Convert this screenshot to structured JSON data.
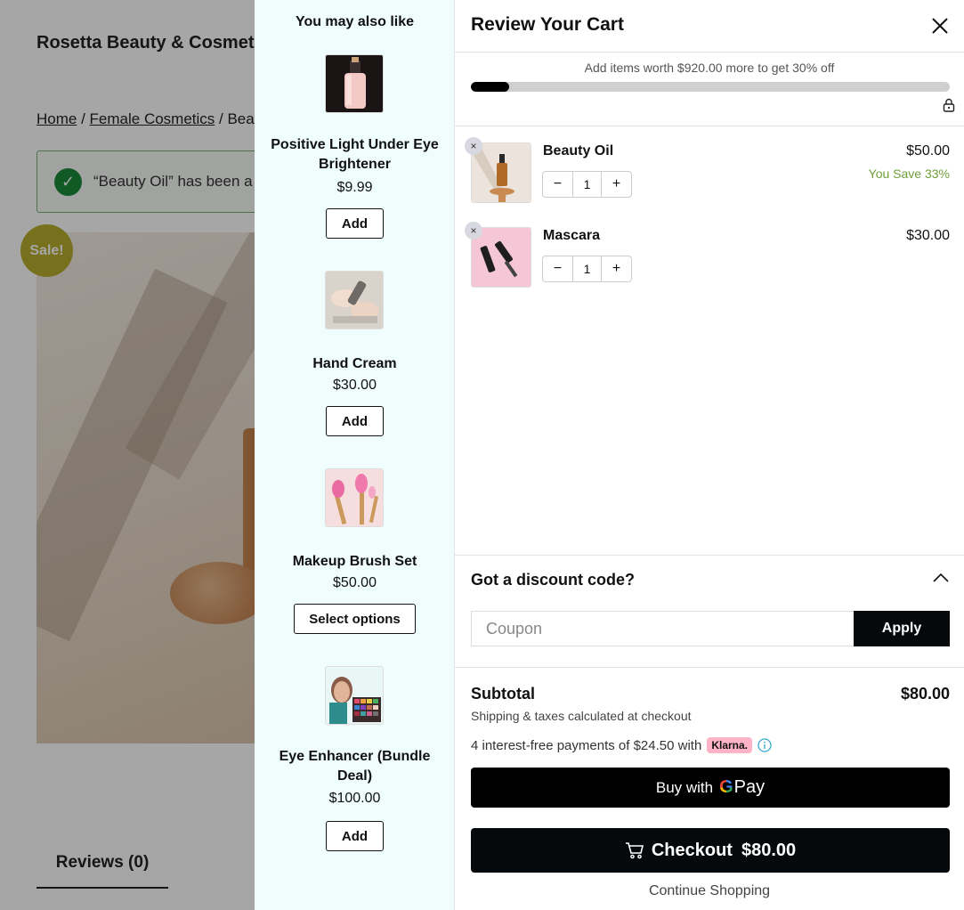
{
  "background_page": {
    "site_title": "Rosetta Beauty & Cosmet",
    "breadcrumb": {
      "home": "Home",
      "sep": " / ",
      "category": "Female Cosmetics",
      "current": "Bea"
    },
    "notice_text": "“Beauty Oil” has been a",
    "sale_badge": "Sale!",
    "reviews_tab": "Reviews (0)"
  },
  "upsell": {
    "title": "You may also like",
    "items": [
      {
        "name": "Positive Light Under Eye Brightener",
        "price": "$9.99",
        "button": "Add",
        "icon": "serum-bottle-image"
      },
      {
        "name": "Hand Cream",
        "price": "$30.00",
        "button": "Add",
        "icon": "hand-cream-image"
      },
      {
        "name": "Makeup Brush Set",
        "price": "$50.00",
        "button": "Select options",
        "icon": "brush-set-image"
      },
      {
        "name": "Eye Enhancer (Bundle Deal)",
        "price": "$100.00",
        "button": "Add",
        "icon": "eye-palette-image"
      }
    ]
  },
  "cart": {
    "title": "Review Your Cart",
    "progress_text": "Add items worth $920.00 more to get 30% off",
    "progress_fraction": 0.08,
    "items": [
      {
        "name": "Beauty Oil",
        "qty": "1",
        "price": "$50.00",
        "save": "You Save 33%",
        "minus": "−",
        "plus": "+",
        "remove": "×"
      },
      {
        "name": "Mascara",
        "qty": "1",
        "price": "$30.00",
        "save": "",
        "minus": "−",
        "plus": "+",
        "remove": "×"
      }
    ],
    "discount": {
      "title": "Got a discount code?",
      "coupon_placeholder": "Coupon",
      "apply_label": "Apply"
    },
    "subtotal_label": "Subtotal",
    "subtotal_value": "$80.00",
    "shipping_note": "Shipping & taxes calculated at checkout",
    "klarna_text": "4 interest-free payments of $24.50 with",
    "klarna_badge": "Klarna.",
    "gpay": {
      "prefix": "Buy with",
      "g": "G",
      "pay": "Pay"
    },
    "checkout": {
      "label": "Checkout",
      "amount": "$80.00"
    },
    "continue_label": "Continue Shopping"
  },
  "colors": {
    "accent_dark": "#05090c",
    "save_green": "#6e9e3b",
    "upsell_bg": "#effdfd",
    "klarna_pink": "#ffb3c7",
    "sale_badge": "#b7ae2e"
  }
}
